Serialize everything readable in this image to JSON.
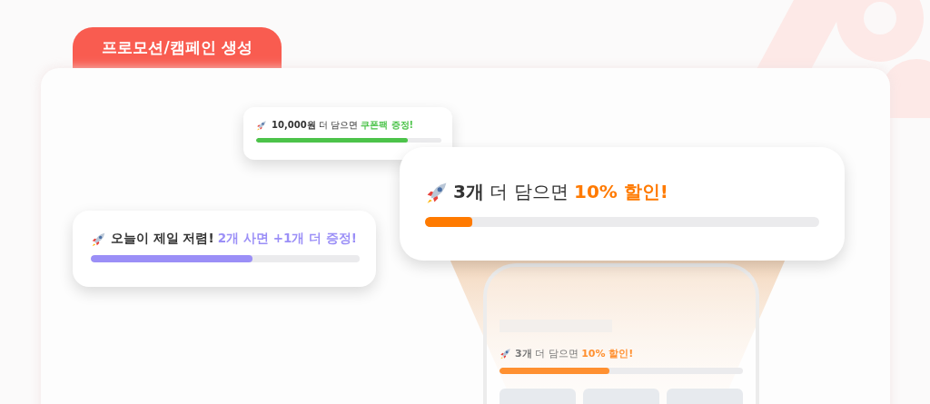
{
  "tab": {
    "label": "프로모션/캠페인 생성"
  },
  "banners": [
    {
      "lead": "10,000원",
      "middle": "더 담으면",
      "highlight": "쿠폰팩 증정!",
      "color": "#4cc34a",
      "level": 0.82
    },
    {
      "lead": "3개",
      "middle": "더 담으면",
      "highlight": "10% 할인!",
      "color": "#ff7a00",
      "level": 0.12
    },
    {
      "lead": "오늘이 제일 저렴!",
      "highlight": "2개 사면 +1개 더 증정!",
      "color": "#9b8ff7",
      "level": 0.6
    }
  ],
  "phone": {
    "banner": {
      "lead": "3개",
      "middle": "더 담으면",
      "highlight": "10% 할인!",
      "color": "#ff9030",
      "level": 0.45
    }
  }
}
